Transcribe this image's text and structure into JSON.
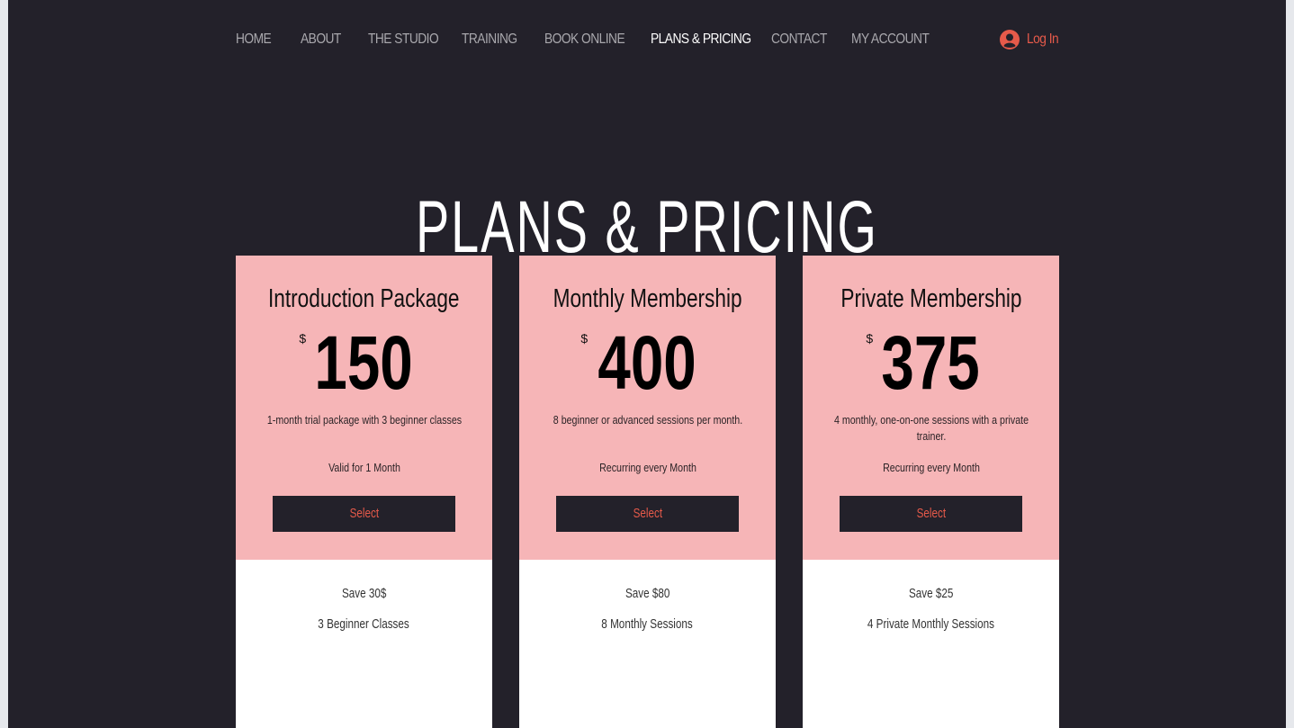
{
  "nav": {
    "items": [
      {
        "label": "HOME",
        "active": false
      },
      {
        "label": "ABOUT",
        "active": false
      },
      {
        "label": "THE STUDIO",
        "active": false
      },
      {
        "label": "TRAINING",
        "active": false
      },
      {
        "label": "BOOK ONLINE",
        "active": false
      },
      {
        "label": "PLANS & PRICING",
        "active": true
      },
      {
        "label": "CONTACT",
        "active": false
      },
      {
        "label": "MY ACCOUNT",
        "active": false
      }
    ],
    "login": {
      "label": "Log In",
      "icon": "user-avatar-icon"
    }
  },
  "page": {
    "title": "PLANS & PRICING"
  },
  "colors": {
    "background": "#23212a",
    "card_accent": "#f6b5b7",
    "accent": "#e65a4a",
    "active_nav": "#ffffff",
    "nav": "#a9a8ad"
  },
  "plans": [
    {
      "name": "Introduction Package",
      "currency": "$",
      "price": "150",
      "description": "1-month trial package with 3 beginner classes",
      "validity": "Valid for 1 Month",
      "button": "Select",
      "features": [
        "Save 30$",
        "3 Beginner Classes"
      ]
    },
    {
      "name": "Monthly Membership",
      "currency": "$",
      "price": "400",
      "description": "8 beginner or advanced sessions per month.",
      "validity": "Recurring every Month",
      "button": "Select",
      "features": [
        "Save $80",
        "8 Monthly Sessions"
      ]
    },
    {
      "name": "Private Membership",
      "currency": "$",
      "price": "375",
      "description": "4 monthly, one-on-one sessions with a private trainer.",
      "validity": "Recurring every Month",
      "button": "Select",
      "features": [
        "Save $25",
        "4 Private Monthly Sessions"
      ]
    }
  ]
}
